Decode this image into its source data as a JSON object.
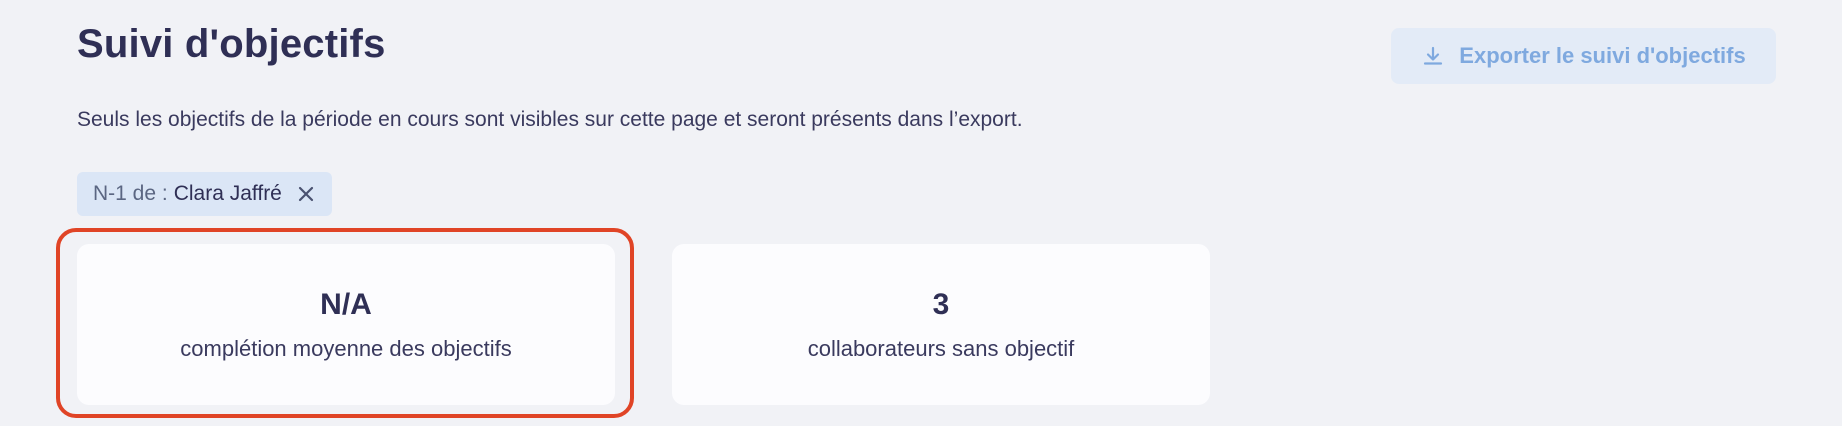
{
  "header": {
    "title": "Suivi d'objectifs",
    "export_button_label": "Exporter le suivi d'objectifs",
    "export_icon": "download-icon"
  },
  "description": "Seuls les objectifs de la période en cours sont visibles sur cette page et seront présents dans l’export.",
  "filter_chip": {
    "prefix": "N-1 de :",
    "value": "Clara Jaffré",
    "close_icon": "close-icon"
  },
  "stats": [
    {
      "value": "N/A",
      "label": "complétion moyenne des objectifs"
    },
    {
      "value": "3",
      "label": "collaborateurs sans objectif"
    }
  ],
  "colors": {
    "background": "#f1f2f6",
    "title": "#2f2f55",
    "button_bg": "#e3ebf7",
    "button_text": "#7fa9df",
    "chip_bg": "#dbe6f6",
    "highlight_border": "#e04426",
    "card_bg": "#fcfcfe"
  }
}
